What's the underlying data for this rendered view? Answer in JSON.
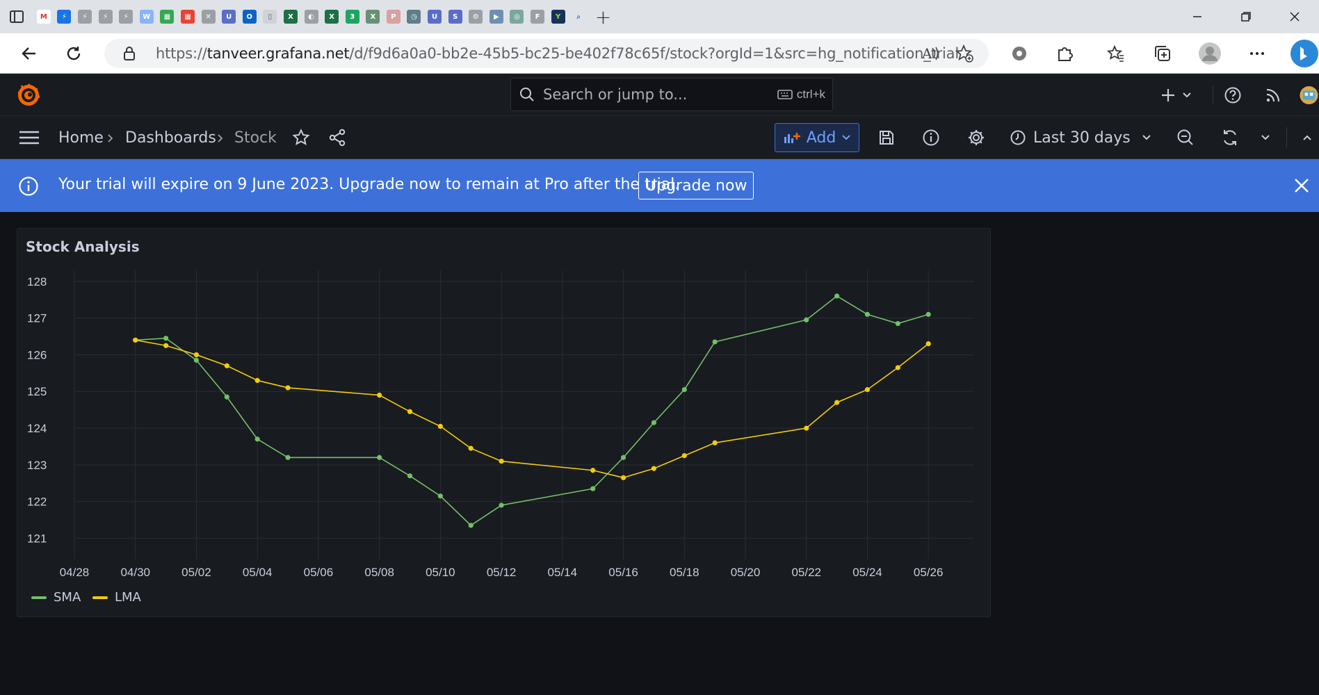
{
  "browser": {
    "url_prefix": "https://",
    "url_host": "tanveer.grafana.net",
    "url_path": "/d/f9d6a0a0-bb2e-45b5-bc25-be402f78c65f/stock?orgId=1&src=hg_notification_trial",
    "tabs": [
      {
        "name": "gmail-tab",
        "color": "#ffffff",
        "glyph": "M",
        "fg": "#d93025"
      },
      {
        "name": "app-tab",
        "color": "#1a73e8",
        "glyph": "⚡",
        "fg": "#fff"
      },
      {
        "name": "app-tab",
        "color": "#9aa0a6",
        "glyph": "⚡",
        "fg": "#fff"
      },
      {
        "name": "app-tab",
        "color": "#9aa0a6",
        "glyph": "⚡",
        "fg": "#fff"
      },
      {
        "name": "app-tab",
        "color": "#9aa0a6",
        "glyph": "⚡",
        "fg": "#fff"
      },
      {
        "name": "app-tab",
        "color": "#8ab4f8",
        "glyph": "W",
        "fg": "#fff"
      },
      {
        "name": "app-tab",
        "color": "#34a853",
        "glyph": "▦",
        "fg": "#fff"
      },
      {
        "name": "app-tab",
        "color": "#ea4335",
        "glyph": "▦",
        "fg": "#fff"
      },
      {
        "name": "app-tab",
        "color": "#9aa0a6",
        "glyph": "✕",
        "fg": "#fff"
      },
      {
        "name": "unilever-tab",
        "color": "#5a6ec8",
        "glyph": "U",
        "fg": "#fff"
      },
      {
        "name": "outlook-tab",
        "color": "#0a64c8",
        "glyph": "O",
        "fg": "#fff"
      },
      {
        "name": "doc-tab",
        "color": "#cfd3d8",
        "glyph": "▯",
        "fg": "#555"
      },
      {
        "name": "excel-tab",
        "color": "#1d7044",
        "glyph": "X",
        "fg": "#fff"
      },
      {
        "name": "app-tab",
        "color": "#9aa0a6",
        "glyph": "◐",
        "fg": "#fff"
      },
      {
        "name": "excel-tab",
        "color": "#1d7044",
        "glyph": "X",
        "fg": "#fff"
      },
      {
        "name": "app-tab",
        "color": "#1fa463",
        "glyph": "3",
        "fg": "#fff"
      },
      {
        "name": "excel-tab",
        "color": "#6a8f75",
        "glyph": "X",
        "fg": "#fff"
      },
      {
        "name": "pdf-tab",
        "color": "#d9a0a0",
        "glyph": "P",
        "fg": "#fff"
      },
      {
        "name": "clock-tab",
        "color": "#607d8b",
        "glyph": "◷",
        "fg": "#fff"
      },
      {
        "name": "unilever-tab",
        "color": "#5a6ec8",
        "glyph": "U",
        "fg": "#fff"
      },
      {
        "name": "app-tab",
        "color": "#5a6ec8",
        "glyph": "S",
        "fg": "#fff"
      },
      {
        "name": "app-tab",
        "color": "#9aa0a6",
        "glyph": "⚙",
        "fg": "#fff"
      },
      {
        "name": "app-tab",
        "color": "#6f8fb0",
        "glyph": "▶",
        "fg": "#fff"
      },
      {
        "name": "app-tab",
        "color": "#7aa7a0",
        "glyph": "◎",
        "fg": "#fff"
      },
      {
        "name": "app-tab",
        "color": "#9aa0a6",
        "glyph": "F",
        "fg": "#fff"
      },
      {
        "name": "app-tab",
        "color": "#16325c",
        "glyph": "Y",
        "fg": "#9fdc3c"
      },
      {
        "name": "search-tab",
        "color": "#dfe3e8",
        "glyph": "⌕",
        "fg": "#3b6fd6"
      },
      {
        "name": "chart-tab",
        "color": "#7aa7d6",
        "glyph": "▮",
        "fg": "#fff"
      },
      {
        "name": "search-tab",
        "color": "#dfe3e8",
        "glyph": "⌕",
        "fg": "#3b6fd6"
      },
      {
        "name": "grafana-tab",
        "color": "#f46800",
        "glyph": "◉",
        "fg": "#fff"
      },
      {
        "name": "grafana-tab",
        "color": "#f4a06a",
        "glyph": "◉",
        "fg": "#fff"
      },
      {
        "name": "grafana-tab",
        "color": "#f4a06a",
        "glyph": "◉",
        "fg": "#fff"
      },
      {
        "name": "search-tab",
        "color": "#dfe3e8",
        "glyph": "⌕",
        "fg": "#3b6fd6"
      },
      {
        "name": "app-tab",
        "color": "#b0b4b9",
        "glyph": "▭",
        "fg": "#fff"
      },
      {
        "name": "app-tab",
        "color": "#b0b4b9",
        "glyph": "▭",
        "fg": "#fff"
      },
      {
        "name": "app-tab",
        "color": "#b0b4b9",
        "glyph": "▭",
        "fg": "#fff"
      },
      {
        "name": "app-tab",
        "color": "#b0b4b9",
        "glyph": "▭",
        "fg": "#fff"
      },
      {
        "name": "mongodb-tab",
        "color": "#13aa52",
        "glyph": "●",
        "fg": "#fff"
      },
      {
        "name": "app-tab",
        "color": "#ffffff",
        "glyph": "▣",
        "fg": "#555"
      },
      {
        "name": "search-tab",
        "color": "#dfe3e8",
        "glyph": "⌕",
        "fg": "#3b6fd6"
      },
      {
        "name": "dev-tab",
        "color": "#333",
        "glyph": "D",
        "fg": "#fff"
      },
      {
        "name": "app-tab",
        "color": "#6a8f75",
        "glyph": "⚡",
        "fg": "#fff"
      },
      {
        "name": "app-tab",
        "color": "#6a8f75",
        "glyph": "⚡",
        "fg": "#fff"
      },
      {
        "name": "search-tab",
        "color": "#dfe3e8",
        "glyph": "⌕",
        "fg": "#1a73e8"
      },
      {
        "name": "app-tab",
        "color": "#4a7bd0",
        "glyph": "A",
        "fg": "#fff"
      },
      {
        "name": "app-tab",
        "color": "#f2c08a",
        "glyph": "/",
        "fg": "#fff"
      },
      {
        "name": "app-tab",
        "color": "#f2c08a",
        "glyph": "/",
        "fg": "#fff"
      },
      {
        "name": "search-tab",
        "color": "#dfe3e8",
        "glyph": "⌕",
        "fg": "#1a73e8"
      },
      {
        "name": "linkedin-tab",
        "color": "#0a66c2",
        "glyph": "in",
        "fg": "#fff"
      },
      {
        "name": "github-tab",
        "color": "#24292f",
        "glyph": "◯",
        "fg": "#fff"
      }
    ],
    "active_tab_index": 30
  },
  "grafana": {
    "search_placeholder": "Search or jump to...",
    "search_shortcut": "ctrl+k",
    "breadcrumb": {
      "home": "Home",
      "dashboards": "Dashboards",
      "current": "Stock"
    },
    "add_label": "Add",
    "time_range": "Last 30 days",
    "banner_text": "Your trial will expire on 9 June 2023. Upgrade now to remain at Pro after the trial.",
    "upgrade_label": "Upgrade now",
    "panel_title": "Stock Analysis"
  },
  "colors": {
    "sma": "#73bf69",
    "lma": "#f2cc0c",
    "banner": "#3d71d9",
    "accent": "#6e9fff"
  },
  "chart_data": {
    "type": "line",
    "title": "Stock Analysis",
    "x_tick_labels": [
      "04/28",
      "04/30",
      "05/02",
      "05/04",
      "05/06",
      "05/08",
      "05/10",
      "05/12",
      "05/14",
      "05/16",
      "05/18",
      "05/20",
      "05/22",
      "05/24",
      "05/26"
    ],
    "y_tick_labels": [
      "121",
      "122",
      "123",
      "124",
      "125",
      "126",
      "127",
      "128"
    ],
    "ylim": [
      120.8,
      128.3
    ],
    "x_range_days": [
      0,
      29.5
    ],
    "x_origin_label": "04/28",
    "legend_placement": "bottom-left",
    "series": [
      {
        "name": "SMA",
        "color": "#73bf69",
        "points": [
          [
            2,
            126.4
          ],
          [
            3,
            126.45
          ],
          [
            4,
            125.85
          ],
          [
            5,
            124.85
          ],
          [
            6,
            123.7
          ],
          [
            7,
            123.2
          ],
          [
            10,
            123.2
          ],
          [
            11,
            122.7
          ],
          [
            12,
            122.15
          ],
          [
            13,
            121.35
          ],
          [
            14,
            121.9
          ],
          [
            17,
            122.35
          ],
          [
            18,
            123.2
          ],
          [
            19,
            124.15
          ],
          [
            20,
            125.05
          ],
          [
            21,
            126.35
          ],
          [
            24,
            126.95
          ],
          [
            25,
            127.6
          ],
          [
            26,
            127.1
          ],
          [
            27,
            126.85
          ],
          [
            28,
            127.1
          ]
        ]
      },
      {
        "name": "LMA",
        "color": "#f2cc0c",
        "points": [
          [
            2,
            126.4
          ],
          [
            3,
            126.25
          ],
          [
            4,
            126.0
          ],
          [
            5,
            125.7
          ],
          [
            6,
            125.3
          ],
          [
            7,
            125.1
          ],
          [
            10,
            124.9
          ],
          [
            11,
            124.45
          ],
          [
            12,
            124.05
          ],
          [
            13,
            123.45
          ],
          [
            14,
            123.1
          ],
          [
            17,
            122.85
          ],
          [
            18,
            122.65
          ],
          [
            19,
            122.9
          ],
          [
            20,
            123.25
          ],
          [
            21,
            123.6
          ],
          [
            24,
            124.0
          ],
          [
            25,
            124.7
          ],
          [
            26,
            125.05
          ],
          [
            27,
            125.65
          ],
          [
            28,
            126.3
          ]
        ]
      }
    ]
  }
}
